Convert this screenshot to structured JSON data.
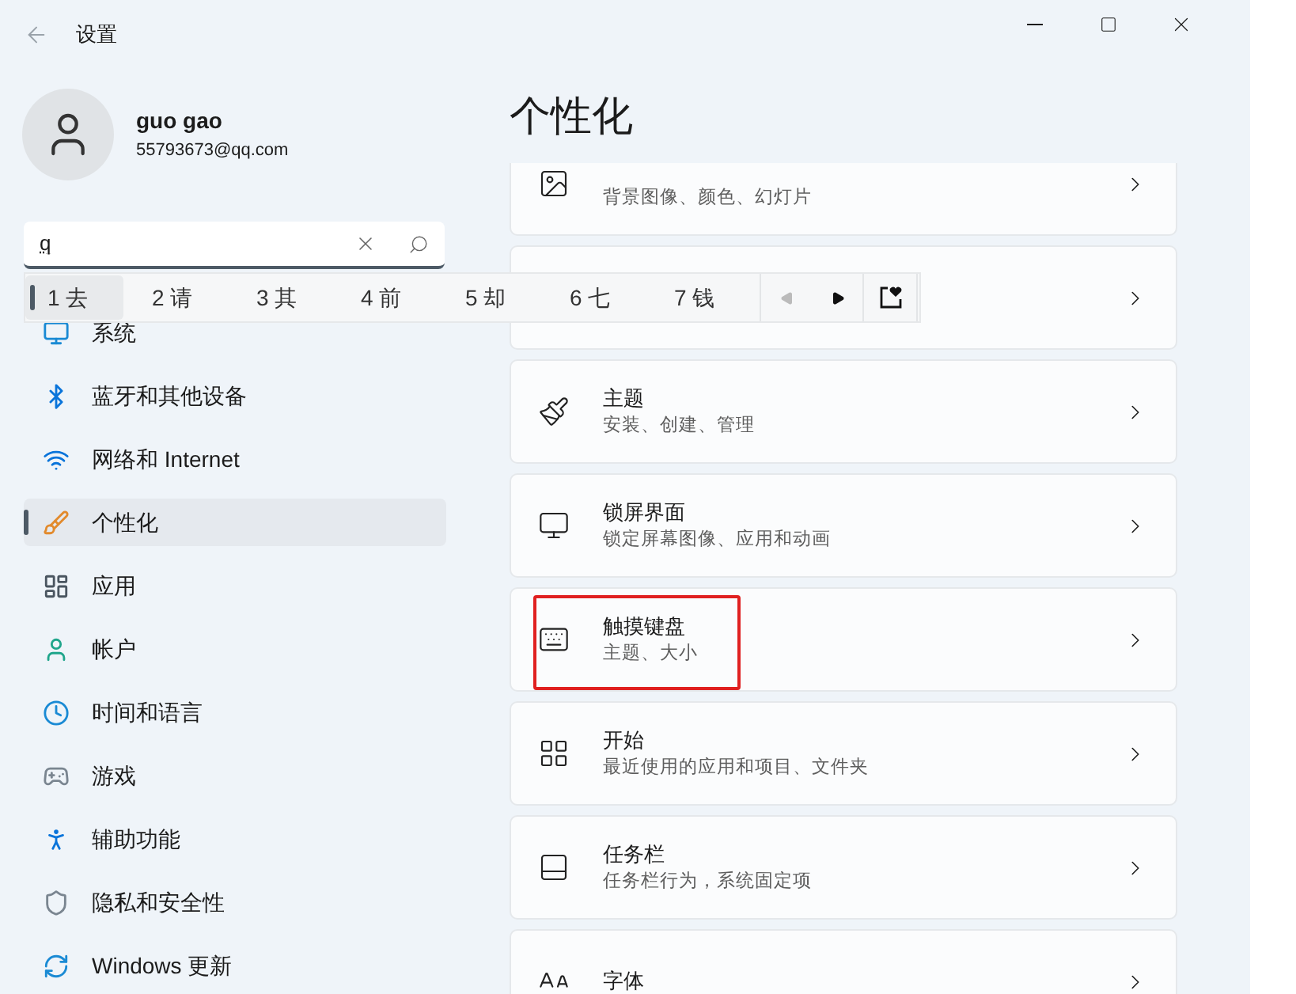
{
  "window": {
    "title": "设置"
  },
  "profile": {
    "name": "guo gao",
    "email": "55793673@qq.com"
  },
  "search": {
    "value": "q",
    "focused": true
  },
  "ime": {
    "candidates": [
      {
        "label": "1 去",
        "selected": true
      },
      {
        "label": "2 请",
        "selected": false
      },
      {
        "label": "3 其",
        "selected": false
      },
      {
        "label": "4 前",
        "selected": false
      },
      {
        "label": "5 却",
        "selected": false
      },
      {
        "label": "6 七",
        "selected": false
      },
      {
        "label": "7 钱",
        "selected": false
      }
    ],
    "previous_disabled": true,
    "next_disabled": false
  },
  "sidebar": {
    "items": [
      {
        "label": "系统",
        "selected": false
      },
      {
        "label": "蓝牙和其他设备",
        "selected": false
      },
      {
        "label": "网络和 Internet",
        "selected": false
      },
      {
        "label": "个性化",
        "selected": true
      },
      {
        "label": "应用",
        "selected": false
      },
      {
        "label": "帐户",
        "selected": false
      },
      {
        "label": "时间和语言",
        "selected": false
      },
      {
        "label": "游戏",
        "selected": false
      },
      {
        "label": "辅助功能",
        "selected": false
      },
      {
        "label": "隐私和安全性",
        "selected": false
      },
      {
        "label": "Windows 更新",
        "selected": false
      }
    ]
  },
  "page": {
    "title": "个性化"
  },
  "cards": [
    {
      "subtitle": "背景图像、颜色、幻灯片",
      "highlighted": false
    },
    {
      "highlighted": false
    },
    {
      "title": "主题",
      "subtitle": "安装、创建、管理",
      "highlighted": false
    },
    {
      "title": "锁屏界面",
      "subtitle": "锁定屏幕图像、应用和动画",
      "highlighted": false
    },
    {
      "title": "触摸键盘",
      "subtitle": "主题、大小",
      "highlighted": true
    },
    {
      "title": "开始",
      "subtitle": "最近使用的应用和项目、文件夹",
      "highlighted": false
    },
    {
      "title": "任务栏",
      "subtitle": "任务栏行为，系统固定项",
      "highlighted": false
    },
    {
      "title": "字体",
      "highlighted": false
    }
  ]
}
